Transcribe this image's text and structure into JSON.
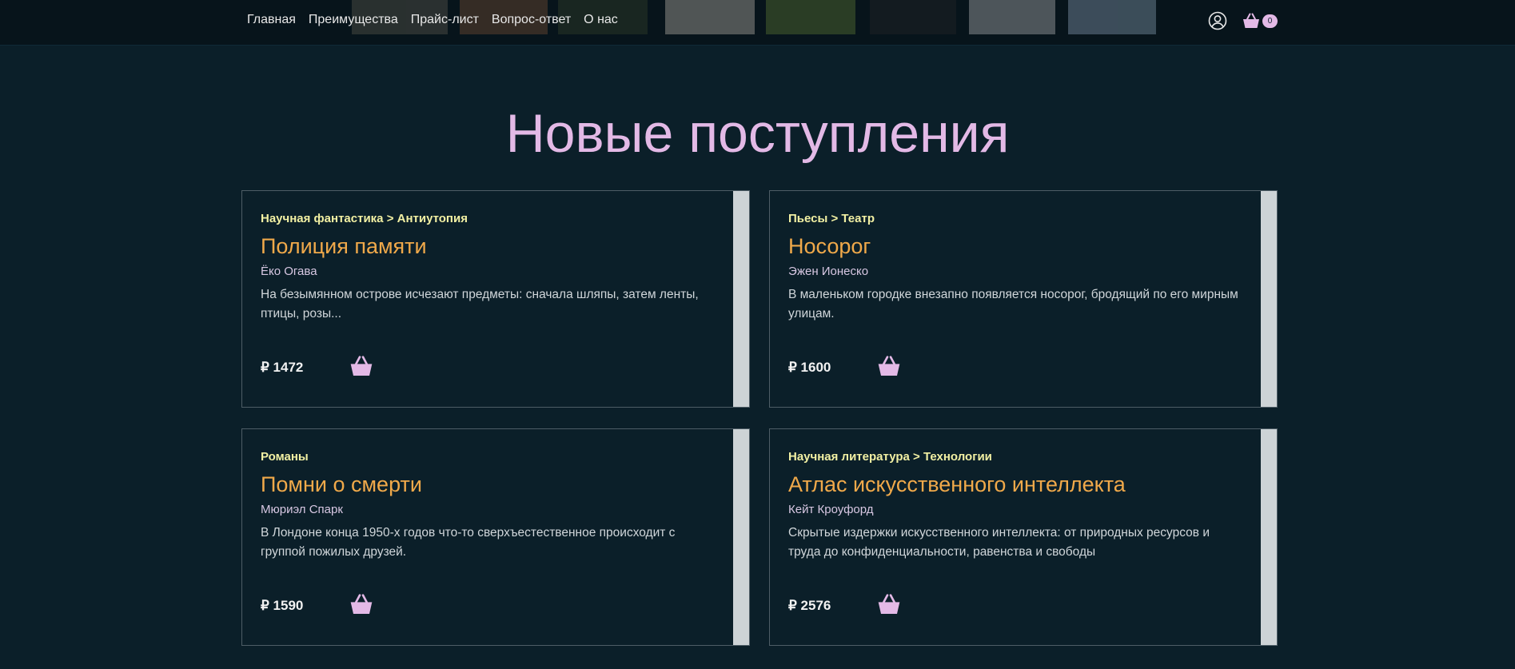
{
  "nav": {
    "items": [
      {
        "label": "Главная"
      },
      {
        "label": "Преимущества"
      },
      {
        "label": "Прайс-лист"
      },
      {
        "label": "Вопрос-ответ"
      },
      {
        "label": "О нас"
      }
    ]
  },
  "header": {
    "user_icon": "user-icon",
    "cart_icon": "basket-icon",
    "cart_count": "0"
  },
  "section": {
    "title": "Новые поступления"
  },
  "cards": [
    {
      "category": "Научная фантастика > Антиутопия",
      "title": "Полиция памяти",
      "author": "Ёко Огава",
      "description": "На безымянном острове исчезают предметы: сначала шляпы, затем ленты, птицы, розы...",
      "price": "₽ 1472"
    },
    {
      "category": "Пьесы > Театр",
      "title": "Носорог",
      "author": "Эжен Ионеско",
      "description": "В маленьком городке внезапно появляется носорог, бродящий по его мирным улицам.",
      "price": "₽ 1600"
    },
    {
      "category": "Романы",
      "title": "Помни о смерти",
      "author": "Мюриэл Спарк",
      "description": "В Лондоне конца 1950-х годов что-то сверхъестественное происходит с группой пожилых друзей.",
      "price": "₽ 1590"
    },
    {
      "category": "Научная литература > Технологии",
      "title": "Атлас искусственного интеллекта",
      "author": "Кейт Кроуфорд",
      "description": "Скрытые издержки искусственного интеллекта: от природных ресурсов и труда до конфиденциальности, равенства и свободы",
      "price": "₽ 2576"
    }
  ],
  "colors": {
    "background": "#0b1f29",
    "accent": "#e3b9e6",
    "title": "#f0a94a",
    "category": "#f2f0a3"
  }
}
